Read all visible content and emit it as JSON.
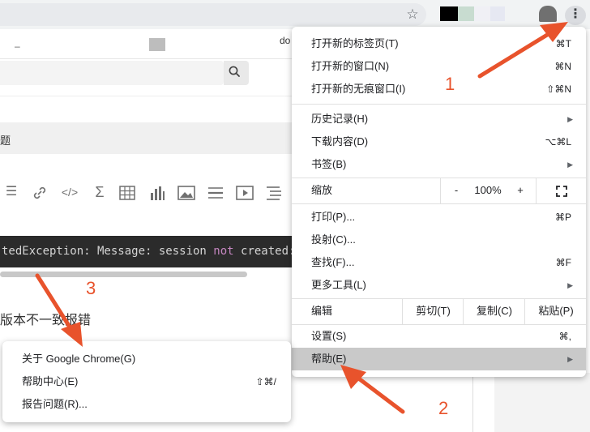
{
  "browser": {
    "extension_colors": [
      "#000000",
      "#c8dcd0",
      "#f0f0f5",
      "#e6e8f2",
      "#707070"
    ]
  },
  "page": {
    "header_dash": "–",
    "header_doc": "do",
    "title_fragment": "题",
    "code_line": {
      "before": "tedException: Message: session ",
      "keyword": "not",
      "after": " created:"
    },
    "body_fragment": "版本不一致报错"
  },
  "menu": {
    "new_tab": {
      "label": "打开新的标签页(T)",
      "shortcut": "⌘T"
    },
    "new_window": {
      "label": "打开新的窗口(N)",
      "shortcut": "⌘N"
    },
    "new_incognito": {
      "label": "打开新的无痕窗口(I)",
      "shortcut": "⇧⌘N"
    },
    "history": {
      "label": "历史记录(H)"
    },
    "downloads": {
      "label": "下载内容(D)",
      "shortcut": "⌥⌘L"
    },
    "bookmarks": {
      "label": "书签(B)"
    },
    "zoom": {
      "label": "缩放",
      "minus": "-",
      "level": "100%",
      "plus": "+"
    },
    "print": {
      "label": "打印(P)...",
      "shortcut": "⌘P"
    },
    "cast": {
      "label": "投射(C)..."
    },
    "find": {
      "label": "查找(F)...",
      "shortcut": "⌘F"
    },
    "more_tools": {
      "label": "更多工具(L)"
    },
    "edit": {
      "label": "编辑",
      "cut": "剪切(T)",
      "copy": "复制(C)",
      "paste": "粘贴(P)"
    },
    "settings": {
      "label": "设置(S)",
      "shortcut": "⌘,"
    },
    "help": {
      "label": "帮助(E)"
    }
  },
  "help_submenu": {
    "about": {
      "label": "关于 Google Chrome(G)"
    },
    "help_center": {
      "label": "帮助中心(E)",
      "shortcut": "⇧⌘/"
    },
    "report": {
      "label": "报告问题(R)..."
    }
  },
  "annotations": {
    "step1": "1",
    "step2": "2",
    "step3": "3",
    "color": "#e8532c"
  }
}
